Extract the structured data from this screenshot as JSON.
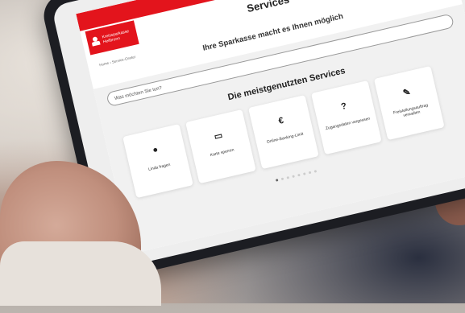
{
  "screen": {
    "brand_line1": "Kreissparkasse",
    "brand_line2": "Heilbronn",
    "title": "Services",
    "breadcrumb": "Home › Service-Center",
    "subtitle": "Ihre Sparkasse macht es Ihnen möglich",
    "search_placeholder": "Was möchten Sie tun?",
    "section_title": "Die meistgenutzten Services",
    "cards": [
      {
        "icon": "chat-bubble-icon",
        "glyph": "●",
        "label": "Linda fragen"
      },
      {
        "icon": "card-icon",
        "glyph": "▭",
        "label": "Karte sperren"
      },
      {
        "icon": "euro-icon",
        "glyph": "€",
        "label": "Online-Banking-Limit"
      },
      {
        "icon": "question-icon",
        "glyph": "?",
        "label": "Zugangsdaten vergessen"
      },
      {
        "icon": "edit-icon",
        "glyph": "✎",
        "label": "Freistellungsauftrag verwalten"
      }
    ],
    "carousel_dots": 8,
    "carousel_active": 1
  },
  "colors": {
    "brand_red": "#e3141c"
  }
}
